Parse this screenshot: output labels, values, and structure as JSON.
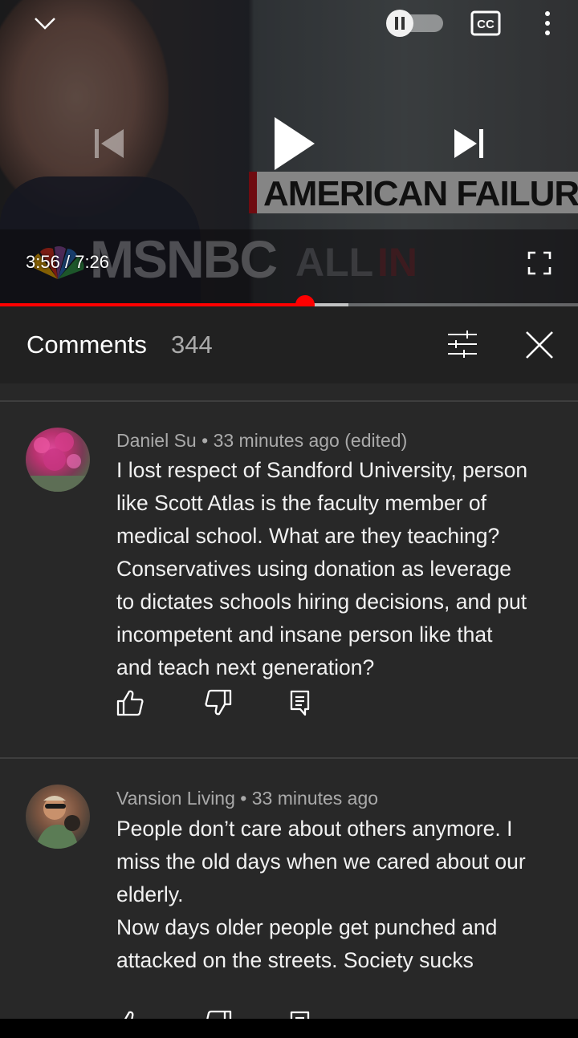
{
  "player": {
    "current_time": "3:56",
    "separator": "/",
    "duration": "7:26",
    "progress": 0.528,
    "buffered": 0.603,
    "overlay": {
      "brand": "MSNBC",
      "show_a": "ALL",
      "show_b": "IN",
      "banner": "AMERICAN FAILURE"
    }
  },
  "comments_panel": {
    "title": "Comments",
    "count": "344",
    "comments": [
      {
        "author": "Daniel Su",
        "dot": "•",
        "time": "33 minutes ago (edited)",
        "text": "I lost respect of Sandford University, person\nlike Scott Atlas is the faculty member of\nmedical school. What are they teaching?\nConservatives using donation as leverage\nto dictates schools hiring decisions, and put\nincompetent and insane person like that\nand teach next generation?"
      },
      {
        "author": "Vansion Living",
        "dot": "•",
        "time": "33 minutes ago",
        "text": "People don’t care about others anymore. I\nmiss the old days when we cared about our\nelderly.\nNow days older people get punched and\nattacked on the streets. Society sucks"
      }
    ]
  },
  "colors": {
    "accent": "#ff0000",
    "panel_bg": "#282828",
    "header_bg": "#212121",
    "text_primary": "#f1f1f1",
    "text_secondary": "#aaaaaa"
  },
  "icons": [
    "collapse-chevron-icon",
    "autoplay-toggle-icon",
    "captions-icon",
    "more-vertical-icon",
    "previous-icon",
    "play-icon",
    "next-icon",
    "fullscreen-icon",
    "sort-filter-icon",
    "close-icon",
    "like-icon",
    "dislike-icon",
    "reply-icon"
  ]
}
